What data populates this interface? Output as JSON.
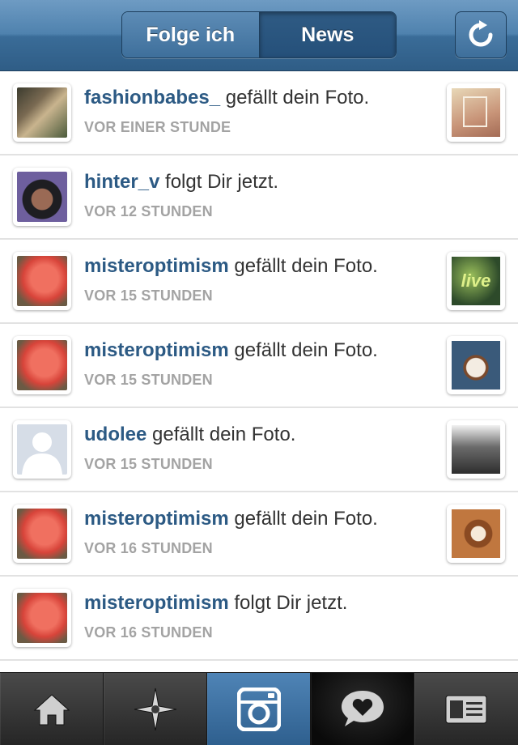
{
  "header": {
    "tabs": [
      {
        "label": "Folge ich",
        "active": false
      },
      {
        "label": "News",
        "active": true
      }
    ],
    "refresh_icon": "refresh-icon"
  },
  "feed": [
    {
      "user": "fashionbabes_",
      "action": " gefällt dein Foto.",
      "time": "VOR EINER STUNDE",
      "has_thumb": true
    },
    {
      "user": "hinter_v",
      "action": " folgt Dir jetzt.",
      "time": "VOR 12 STUNDEN",
      "has_thumb": false
    },
    {
      "user": "misteroptimism",
      "action": " gefällt dein Foto.",
      "time": "VOR 15 STUNDEN",
      "has_thumb": true
    },
    {
      "user": "misteroptimism",
      "action": " gefällt dein Foto.",
      "time": "VOR 15 STUNDEN",
      "has_thumb": true
    },
    {
      "user": "udolee",
      "action": " gefällt dein Foto.",
      "time": "VOR 15 STUNDEN",
      "has_thumb": true
    },
    {
      "user": "misteroptimism",
      "action": " gefällt dein Foto.",
      "time": "VOR 16 STUNDEN",
      "has_thumb": true
    },
    {
      "user": "misteroptimism",
      "action": " folgt Dir jetzt.",
      "time": "VOR 16 STUNDEN",
      "has_thumb": false
    }
  ],
  "thumb_texts": {
    "live": "live"
  },
  "tabbar": {
    "items": [
      {
        "icon": "home-icon"
      },
      {
        "icon": "explore-star-icon"
      },
      {
        "icon": "camera-icon"
      },
      {
        "icon": "news-heart-bubble-icon",
        "active": true
      },
      {
        "icon": "profile-card-icon"
      }
    ]
  },
  "colors": {
    "header_blue": "#4f82ae",
    "username": "#2c5a84",
    "timestamp": "#a3a3a3",
    "text": "#333333"
  }
}
